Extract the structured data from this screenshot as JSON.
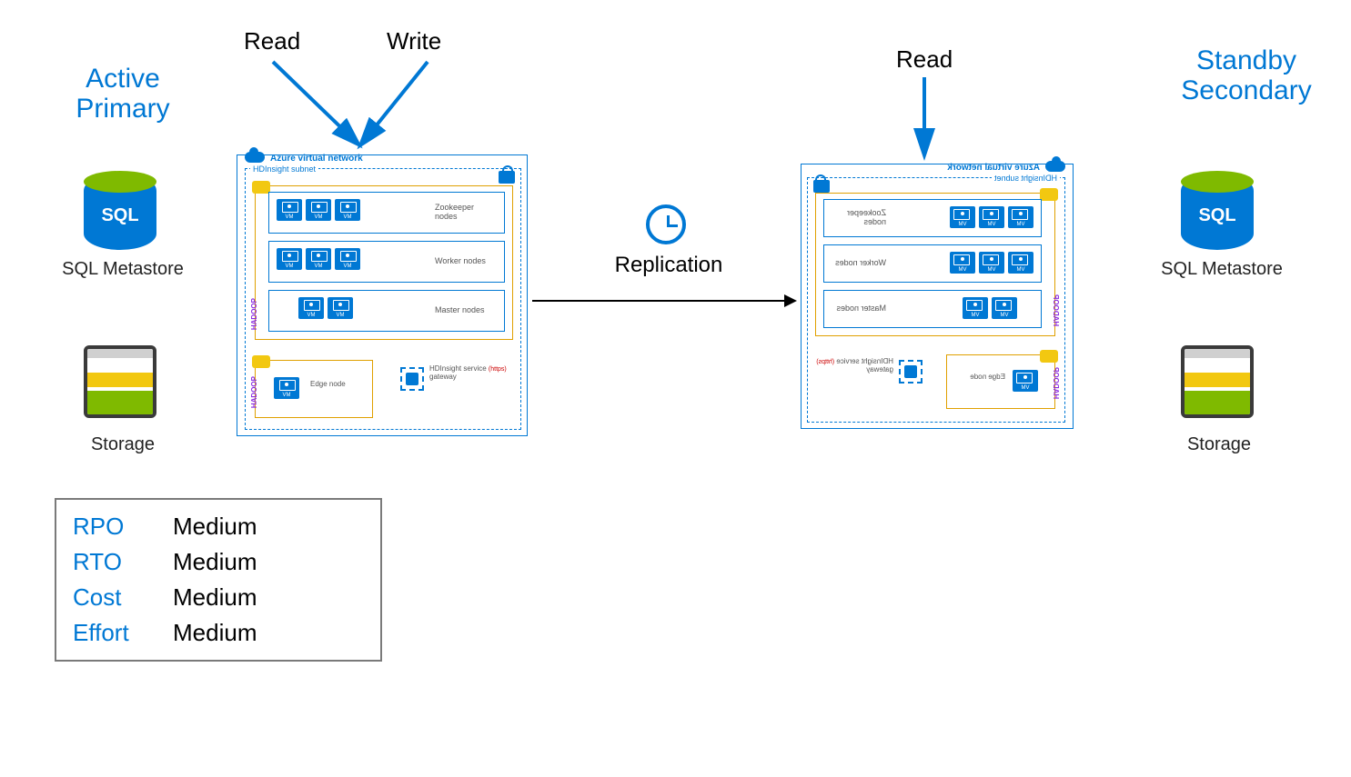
{
  "labels": {
    "read": "Read",
    "write": "Write",
    "replication": "Replication"
  },
  "primary": {
    "title_line1": "Active",
    "title_line2": "Primary",
    "sql_label": "SQL Metastore",
    "sql_badge": "SQL",
    "storage_label": "Storage"
  },
  "secondary": {
    "title_line1": "Standby",
    "title_line2": "Secondary",
    "sql_label": "SQL Metastore",
    "sql_badge": "SQL",
    "storage_label": "Storage"
  },
  "cluster": {
    "vnet_label": "Azure virtual network",
    "subnet_label": "HDInsight subnet",
    "hadoop_label": "HADOOP",
    "tiers": {
      "zookeeper": "Zookeeper nodes",
      "worker": "Worker nodes",
      "master": "Master nodes"
    },
    "edge_label": "Edge node",
    "gateway_label": "HDInsight service",
    "gateway_sub": "(https)",
    "gateway_sub2": "gateway"
  },
  "metrics": [
    {
      "key": "RPO",
      "value": "Medium"
    },
    {
      "key": "RTO",
      "value": "Medium"
    },
    {
      "key": "Cost",
      "value": "Medium"
    },
    {
      "key": "Effort",
      "value": "Medium"
    }
  ]
}
